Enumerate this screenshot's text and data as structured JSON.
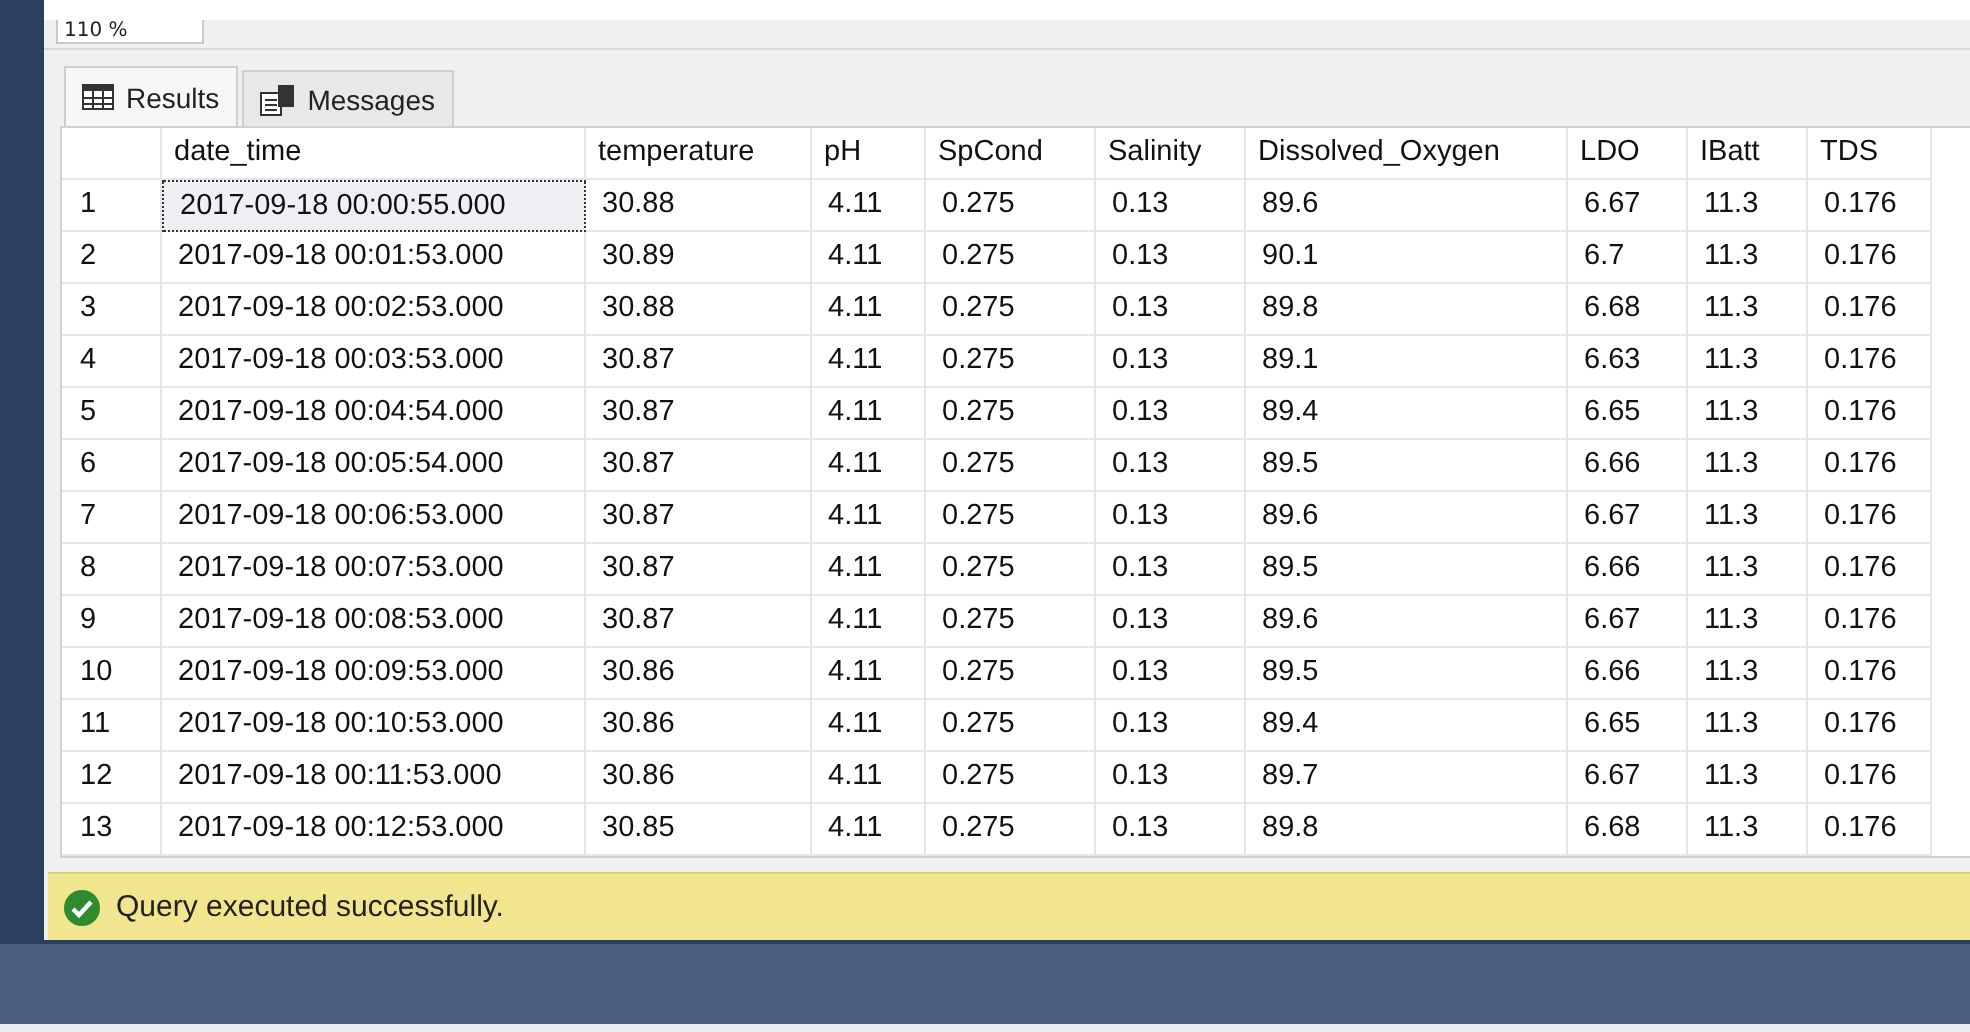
{
  "zoom": {
    "value": "110 %"
  },
  "tabs": [
    {
      "label": "Results",
      "kind": "grid",
      "selected": true
    },
    {
      "label": "Messages",
      "kind": "messages",
      "selected": false
    }
  ],
  "grid": {
    "columns": [
      "date_time",
      "temperature",
      "pH",
      "SpCond",
      "Salinity",
      "Dissolved_Oxygen",
      "LDO",
      "IBatt",
      "TDS"
    ],
    "rows": [
      {
        "number": "1",
        "selected": true,
        "cells": [
          "2017-09-18 00:00:55.000",
          "30.88",
          "4.11",
          "0.275",
          "0.13",
          "89.6",
          "6.67",
          "11.3",
          "0.176"
        ]
      },
      {
        "number": "2",
        "selected": false,
        "cells": [
          "2017-09-18 00:01:53.000",
          "30.89",
          "4.11",
          "0.275",
          "0.13",
          "90.1",
          "6.7",
          "11.3",
          "0.176"
        ]
      },
      {
        "number": "3",
        "selected": false,
        "cells": [
          "2017-09-18 00:02:53.000",
          "30.88",
          "4.11",
          "0.275",
          "0.13",
          "89.8",
          "6.68",
          "11.3",
          "0.176"
        ]
      },
      {
        "number": "4",
        "selected": false,
        "cells": [
          "2017-09-18 00:03:53.000",
          "30.87",
          "4.11",
          "0.275",
          "0.13",
          "89.1",
          "6.63",
          "11.3",
          "0.176"
        ]
      },
      {
        "number": "5",
        "selected": false,
        "cells": [
          "2017-09-18 00:04:54.000",
          "30.87",
          "4.11",
          "0.275",
          "0.13",
          "89.4",
          "6.65",
          "11.3",
          "0.176"
        ]
      },
      {
        "number": "6",
        "selected": false,
        "cells": [
          "2017-09-18 00:05:54.000",
          "30.87",
          "4.11",
          "0.275",
          "0.13",
          "89.5",
          "6.66",
          "11.3",
          "0.176"
        ]
      },
      {
        "number": "7",
        "selected": false,
        "cells": [
          "2017-09-18 00:06:53.000",
          "30.87",
          "4.11",
          "0.275",
          "0.13",
          "89.6",
          "6.67",
          "11.3",
          "0.176"
        ]
      },
      {
        "number": "8",
        "selected": false,
        "cells": [
          "2017-09-18 00:07:53.000",
          "30.87",
          "4.11",
          "0.275",
          "0.13",
          "89.5",
          "6.66",
          "11.3",
          "0.176"
        ]
      },
      {
        "number": "9",
        "selected": false,
        "cells": [
          "2017-09-18 00:08:53.000",
          "30.87",
          "4.11",
          "0.275",
          "0.13",
          "89.6",
          "6.67",
          "11.3",
          "0.176"
        ]
      },
      {
        "number": "10",
        "selected": false,
        "cells": [
          "2017-09-18 00:09:53.000",
          "30.86",
          "4.11",
          "0.275",
          "0.13",
          "89.5",
          "6.66",
          "11.3",
          "0.176"
        ]
      },
      {
        "number": "11",
        "selected": false,
        "cells": [
          "2017-09-18 00:10:53.000",
          "30.86",
          "4.11",
          "0.275",
          "0.13",
          "89.4",
          "6.65",
          "11.3",
          "0.176"
        ]
      },
      {
        "number": "12",
        "selected": false,
        "cells": [
          "2017-09-18 00:11:53.000",
          "30.86",
          "4.11",
          "0.275",
          "0.13",
          "89.7",
          "6.67",
          "11.3",
          "0.176"
        ]
      },
      {
        "number": "13",
        "selected": false,
        "cells": [
          "2017-09-18 00:12:53.000",
          "30.85",
          "4.11",
          "0.275",
          "0.13",
          "89.8",
          "6.68",
          "11.3",
          "0.176"
        ]
      }
    ]
  },
  "status_bar": {
    "kind": "success",
    "message": "Query executed successfully."
  }
}
